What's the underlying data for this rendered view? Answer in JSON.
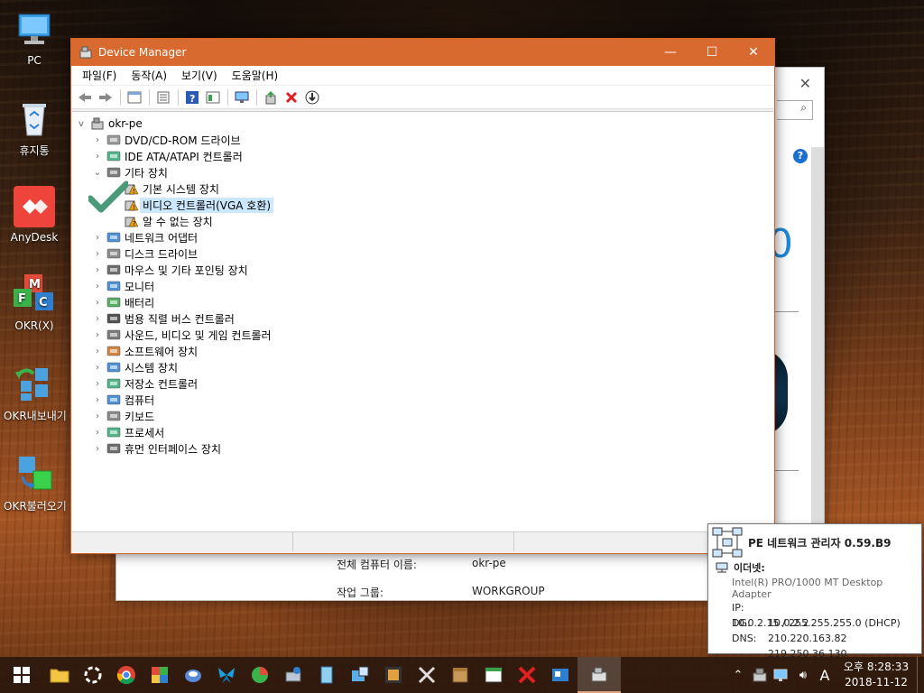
{
  "desktop": {
    "icons": [
      {
        "label": "PC",
        "icon": "pc-icon"
      },
      {
        "label": "휴지통",
        "icon": "recycle-bin-icon"
      },
      {
        "label": "AnyDesk",
        "icon": "anydesk-icon"
      },
      {
        "label": "OKR(X)",
        "icon": "okr-icon"
      },
      {
        "label": "OKR내보내기",
        "icon": "okr-export-icon"
      },
      {
        "label": "OKR불러오기",
        "icon": "okr-import-icon"
      }
    ]
  },
  "device_manager": {
    "title": "Device Manager",
    "menu": [
      "파일(F)",
      "동작(A)",
      "보기(V)",
      "도움말(H)"
    ],
    "root": "okr-pe",
    "tree": [
      {
        "label": "DVD/CD-ROM 드라이브",
        "level": 1,
        "expander": ">",
        "icon": "dvd-drive-icon"
      },
      {
        "label": "IDE ATA/ATAPI 컨트롤러",
        "level": 1,
        "expander": ">",
        "icon": "ide-controller-icon"
      },
      {
        "label": "기타 장치",
        "level": 1,
        "expander": "v",
        "icon": "other-devices-icon"
      },
      {
        "label": "기본 시스템 장치",
        "level": 2,
        "expander": "",
        "icon": "warning-device-icon"
      },
      {
        "label": "비디오 컨트롤러(VGA 호환)",
        "level": 2,
        "expander": "",
        "icon": "warning-device-icon",
        "selected": true
      },
      {
        "label": "알 수 없는 장치",
        "level": 2,
        "expander": "",
        "icon": "unknown-device-icon"
      },
      {
        "label": "네트워크 어댑터",
        "level": 1,
        "expander": ">",
        "icon": "network-adapter-icon"
      },
      {
        "label": "디스크 드라이브",
        "level": 1,
        "expander": ">",
        "icon": "disk-drive-icon"
      },
      {
        "label": "마우스 및 기타 포인팅 장치",
        "level": 1,
        "expander": ">",
        "icon": "mouse-icon"
      },
      {
        "label": "모니터",
        "level": 1,
        "expander": ">",
        "icon": "monitor-icon"
      },
      {
        "label": "배터리",
        "level": 1,
        "expander": ">",
        "icon": "battery-icon"
      },
      {
        "label": "범용 직렬 버스 컨트롤러",
        "level": 1,
        "expander": ">",
        "icon": "usb-icon"
      },
      {
        "label": "사운드, 비디오 및 게임 컨트롤러",
        "level": 1,
        "expander": ">",
        "icon": "sound-icon"
      },
      {
        "label": "소프트웨어 장치",
        "level": 1,
        "expander": ">",
        "icon": "software-device-icon"
      },
      {
        "label": "시스템 장치",
        "level": 1,
        "expander": ">",
        "icon": "system-device-icon"
      },
      {
        "label": "저장소 컨트롤러",
        "level": 1,
        "expander": ">",
        "icon": "storage-controller-icon"
      },
      {
        "label": "컴퓨터",
        "level": 1,
        "expander": ">",
        "icon": "computer-icon"
      },
      {
        "label": "키보드",
        "level": 1,
        "expander": ">",
        "icon": "keyboard-icon"
      },
      {
        "label": "프로세서",
        "level": 1,
        "expander": ">",
        "icon": "processor-icon"
      },
      {
        "label": "휴먼 인터페이스 장치",
        "level": 1,
        "expander": ">",
        "icon": "hid-icon"
      }
    ]
  },
  "background_window": {
    "computer_name_label": "전체 컴퓨터 이름:",
    "computer_name_value": "okr-pe",
    "workgroup_label": "작업 그룹:",
    "workgroup_value": "WORKGROUP",
    "big_text": "0"
  },
  "pe_network": {
    "title": "PE 네트워크 관리자 0.59.B9",
    "adapter_name": "이더넷:",
    "adapter_desc": "Intel(R) PRO/1000 MT Desktop Adapter",
    "ip_label": "IP:",
    "ip_value": "10.0.2.15  /  255.255.255.0 (DHCP)",
    "dg_label": "DG:",
    "dg_value": "10.0.2.2",
    "dns_label": "DNS:",
    "dns_value": "210.220.163.82",
    "dns_value2": "219.250.36.130"
  },
  "clock": {
    "time": "오후 8:28:33",
    "date": "2018-11-12"
  },
  "tray": {
    "ime": "A"
  },
  "colors": {
    "titlebar": "#d86a30",
    "selection": "#cce8ff",
    "accent_blue": "#1e88d8"
  }
}
